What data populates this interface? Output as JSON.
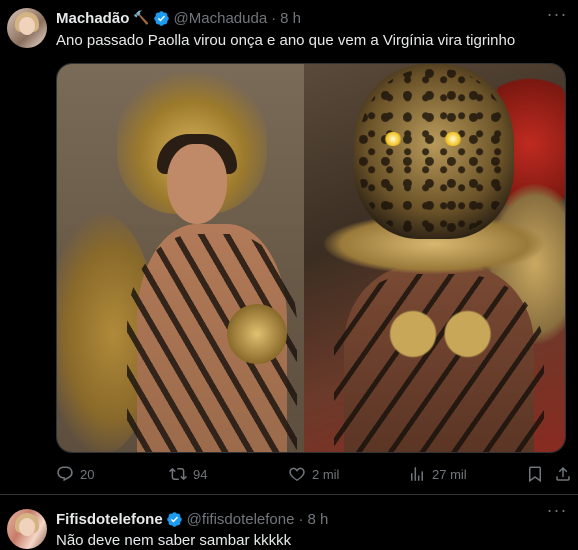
{
  "tweets": [
    {
      "name": "Machadão",
      "name_emoji": "🔨",
      "handle": "@Machaduda",
      "time": "8 h",
      "text": "Ano passado Paolla virou onça e ano que vem a Virgínia vira tigrinho",
      "stats": {
        "replies": "20",
        "retweets": "94",
        "likes": "2 mil",
        "views": "27 mil"
      }
    },
    {
      "name": "Fifisdotelefone",
      "handle": "@fifisdotelefone",
      "time": "8 h",
      "text": "Não deve nem saber sambar kkkkk"
    }
  ],
  "icons": {
    "verified": "verified-badge-icon",
    "more": "more-options-icon",
    "reply": "reply-icon",
    "retweet": "retweet-icon",
    "like": "heart-icon",
    "views": "views-bar-chart-icon",
    "bookmark": "bookmark-icon",
    "share": "share-icon"
  },
  "colors": {
    "background": "#000000",
    "text": "#e7e9ea",
    "muted": "#71767b",
    "verified": "#1d9bf0",
    "divider": "#2f3336"
  }
}
